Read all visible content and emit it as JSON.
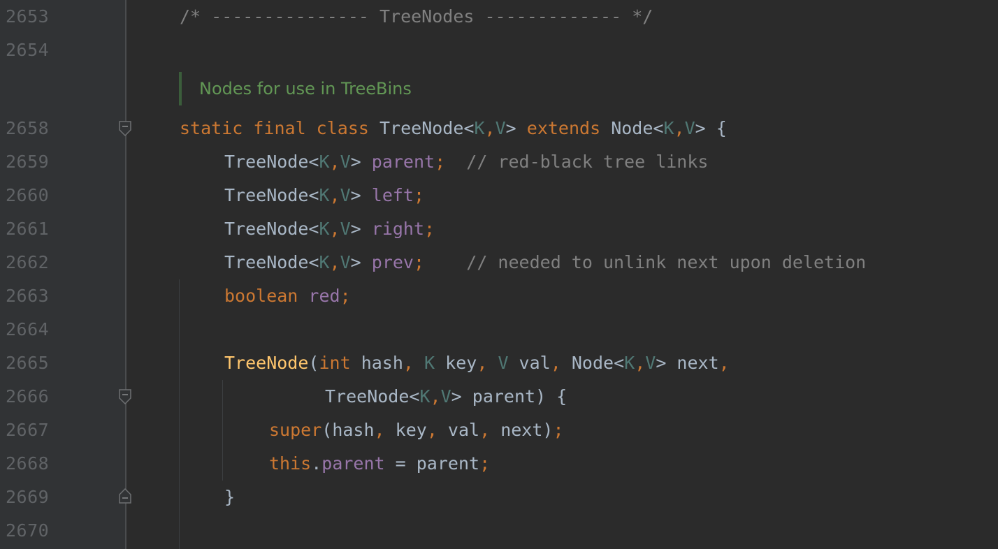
{
  "editor": {
    "line_numbers": [
      "2653",
      "2654",
      "2658",
      "2659",
      "2660",
      "2661",
      "2662",
      "2663",
      "2664",
      "2665",
      "2666",
      "2667",
      "2668",
      "2669",
      "2670"
    ],
    "doc_comment": "Nodes for use in TreeBins",
    "lines": {
      "l2653": "/* --------------- TreeNodes ------------- */",
      "l2659_comment": "// red-black tree links",
      "l2662_comment": "// needed to unlink next upon deletion"
    }
  },
  "colors": {
    "background": "#2b2b2b",
    "gutter": "#313335",
    "keyword": "#cc7832",
    "field": "#9876aa",
    "generic_param": "#507874",
    "comment": "#808080",
    "function": "#ffc66d",
    "doc": "#629755"
  },
  "icons": [
    "fold-open-icon",
    "fold-open-icon",
    "fold-close-icon"
  ]
}
